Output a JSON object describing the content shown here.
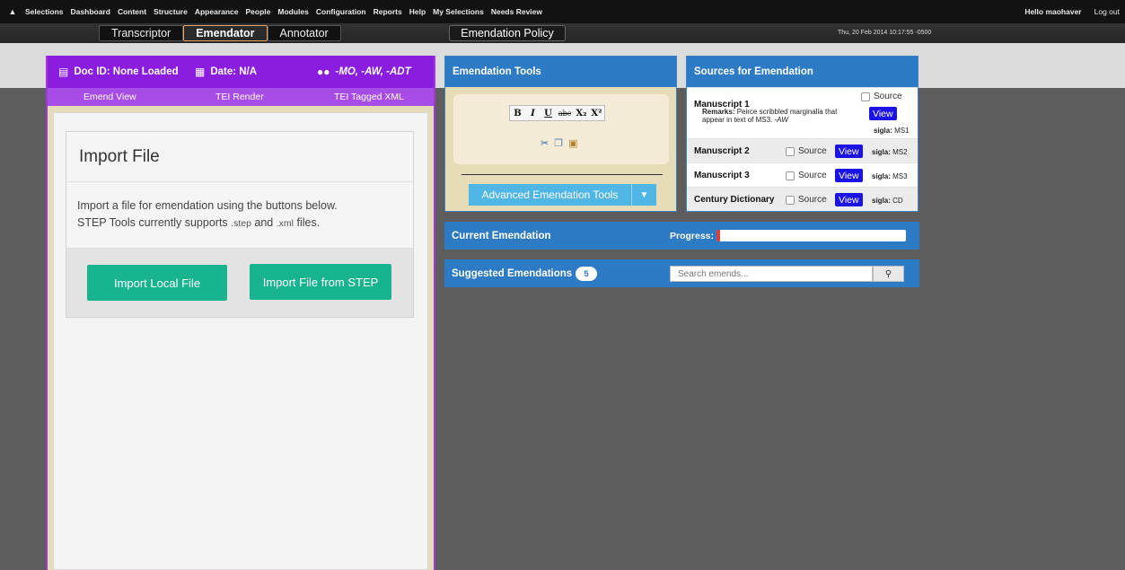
{
  "adminbar": {
    "menu": [
      "Selections",
      "Dashboard",
      "Content",
      "Structure",
      "Appearance",
      "People",
      "Modules",
      "Configuration",
      "Reports",
      "Help",
      "My Selections",
      "Needs Review"
    ],
    "greeting": "Hello maohaver",
    "logout": "Log out"
  },
  "modes": {
    "tabs": [
      "Transcriptor",
      "Emendator",
      "Annotator"
    ],
    "active": "Emendator",
    "policy_button": "Emendation Policy",
    "datetime": "Thu, 20 Feb 2014 10:17:55 -0500"
  },
  "document": {
    "doc_id": "Doc ID: None Loaded",
    "date": "Date: N/A",
    "contributors": "-MO, -AW, -ADT",
    "view_tabs": [
      "Emend View",
      "TEI Render",
      "TEI Tagged XML"
    ],
    "import": {
      "title": "Import File",
      "line1": "Import a file for emendation using the buttons below.",
      "line2_prefix": "STEP Tools currently supports",
      "ext1": ".step",
      "and": "and",
      "ext2": ".xml",
      "line2_suffix": "files.",
      "local_button": "Import Local File",
      "step_button": "Import File from STEP"
    }
  },
  "tools": {
    "title": "Emendation Tools",
    "format_buttons": [
      "B",
      "I",
      "U",
      "abc",
      "X₂",
      "X²"
    ],
    "advanced_button": "Advanced Emendation Tools"
  },
  "sources": {
    "title": "Sources for Emendation",
    "source_label": "Source",
    "view_label": "View",
    "sigla_label": "sigla:",
    "remarks_label": "Remarks:",
    "items": [
      {
        "name": "Manuscript 1",
        "sigla": "MS1",
        "remarks": "Peirce scribbled marginalia that appear in text of MS3.",
        "remarks_author": "-AW"
      },
      {
        "name": "Manuscript 2",
        "sigla": "MS2"
      },
      {
        "name": "Manuscript 3",
        "sigla": "MS3"
      },
      {
        "name": "Century Dictionary",
        "sigla": "CD"
      }
    ]
  },
  "current": {
    "title": "Current Emendation",
    "progress_label": "Progress:",
    "progress_fraction": 0.02
  },
  "suggested": {
    "title": "Suggested Emendations",
    "count": "5",
    "search_placeholder": "Search emends..."
  },
  "colors": {
    "doc_header": "#8a1de0",
    "blue_header": "#2d7bc4",
    "green_button": "#18b48f",
    "view_button": "#1b12e6"
  }
}
